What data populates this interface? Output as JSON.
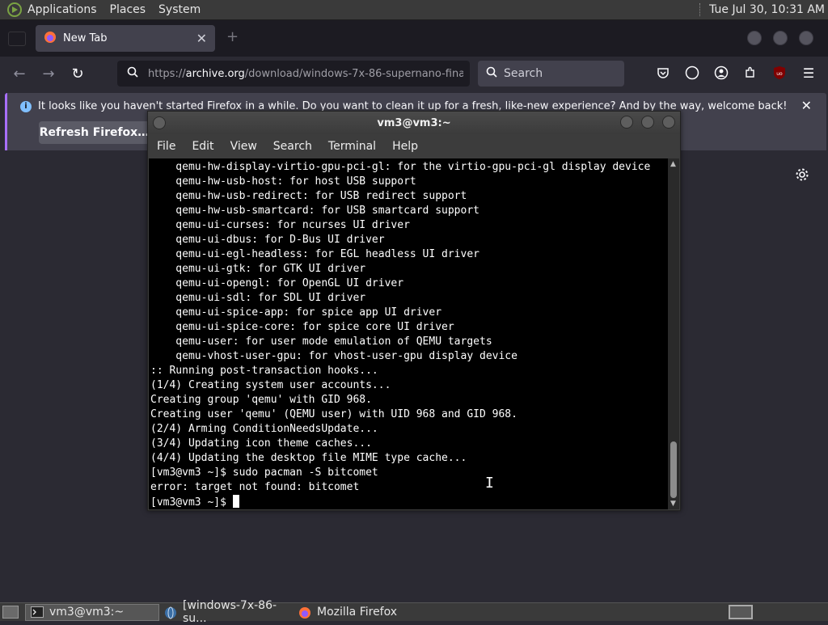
{
  "top_panel": {
    "menus": [
      "Applications",
      "Places",
      "System"
    ],
    "clock": "Tue Jul 30, 10:31 AM"
  },
  "firefox": {
    "tab_title": "New Tab",
    "url": "https://archive.org/download/windows-7x-86-supernano-fina",
    "url_domain": "archive.org",
    "url_prefix": "https://",
    "url_rest": "/download/windows-7x-86-supernano-fina",
    "search_placeholder": "Search",
    "notification_text": "It looks like you haven't started Firefox in a while. Do you want to clean it up for a fresh, like-new experience? And by the way, welcome back!",
    "refresh_button": "Refresh Firefox…"
  },
  "terminal": {
    "title": "vm3@vm3:~",
    "menu": [
      "File",
      "Edit",
      "View",
      "Search",
      "Terminal",
      "Help"
    ],
    "lines": [
      "    qemu-hw-display-virtio-gpu-pci-gl: for the virtio-gpu-pci-gl display device",
      "    qemu-hw-usb-host: for host USB support",
      "    qemu-hw-usb-redirect: for USB redirect support",
      "    qemu-hw-usb-smartcard: for USB smartcard support",
      "    qemu-ui-curses: for ncurses UI driver",
      "    qemu-ui-dbus: for D-Bus UI driver",
      "    qemu-ui-egl-headless: for EGL headless UI driver",
      "    qemu-ui-gtk: for GTK UI driver",
      "    qemu-ui-opengl: for OpenGL UI driver",
      "    qemu-ui-sdl: for SDL UI driver",
      "    qemu-ui-spice-app: for spice app UI driver",
      "    qemu-ui-spice-core: for spice core UI driver",
      "    qemu-user: for user mode emulation of QEMU targets",
      "    qemu-vhost-user-gpu: for vhost-user-gpu display device",
      ":: Running post-transaction hooks...",
      "(1/4) Creating system user accounts...",
      "Creating group 'qemu' with GID 968.",
      "Creating user 'qemu' (QEMU user) with UID 968 and GID 968.",
      "(2/4) Arming ConditionNeedsUpdate...",
      "(3/4) Updating icon theme caches...",
      "(4/4) Updating the desktop file MIME type cache...",
      "[vm3@vm3 ~]$ sudo pacman -S bitcomet",
      "error: target not found: bitcomet"
    ],
    "prompt": "[vm3@vm3 ~]$ "
  },
  "taskbar": {
    "items": [
      "vm3@vm3:~",
      "[windows-7x-86-su...",
      "Mozilla Firefox"
    ]
  }
}
